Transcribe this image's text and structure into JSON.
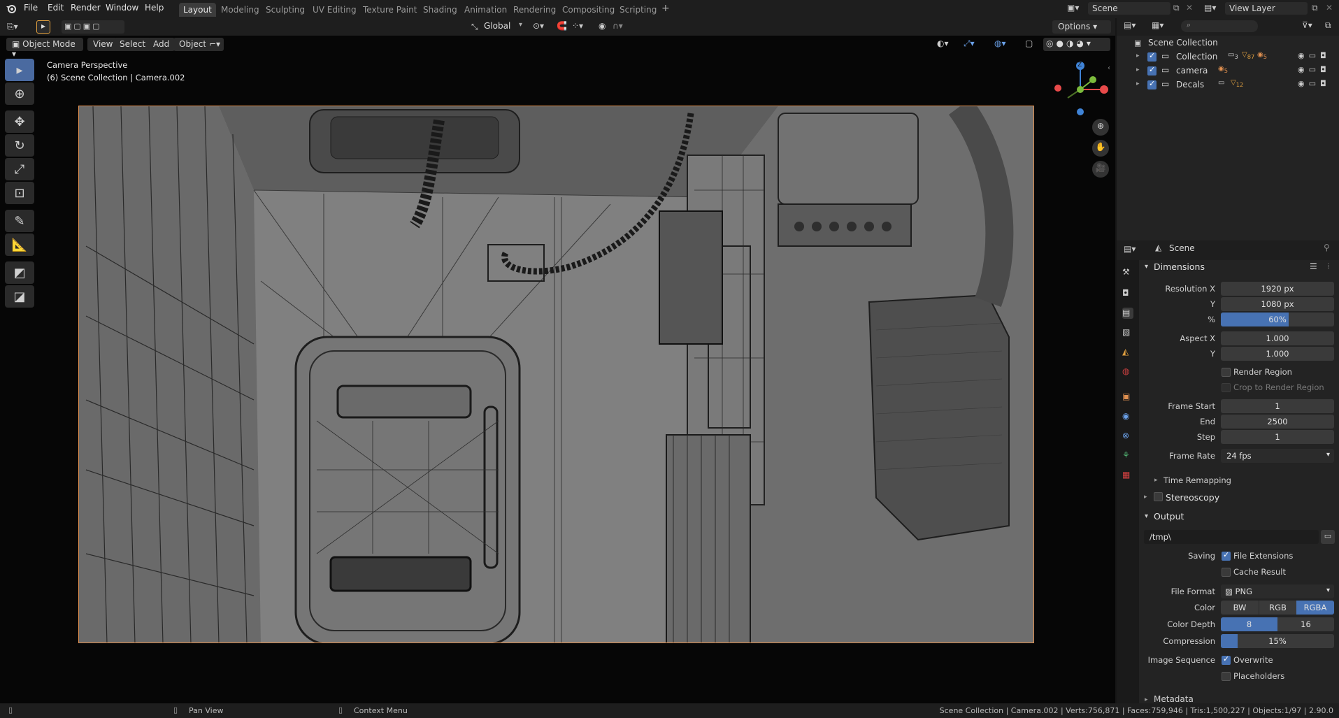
{
  "topbar": {
    "menus": [
      "File",
      "Edit",
      "Render",
      "Window",
      "Help"
    ],
    "workspaces": [
      "Layout",
      "Modeling",
      "Sculpting",
      "UV Editing",
      "Texture Paint",
      "Shading",
      "Animation",
      "Rendering",
      "Compositing",
      "Scripting"
    ],
    "active_workspace": "Layout",
    "scene_name": "Scene",
    "view_layer": "View Layer"
  },
  "toolrow": {
    "transform_orientation": "Global",
    "options_label": "Options"
  },
  "viewport_header": {
    "mode": "Object Mode",
    "view": "View",
    "select": "Select",
    "add": "Add",
    "object": "Object"
  },
  "viewport": {
    "overlay_line1": "Camera Perspective",
    "overlay_line2": "(6) Scene Collection | Camera.002",
    "gizmo_z": "Z"
  },
  "outliner": {
    "root": "Scene Collection",
    "items": [
      {
        "name": "Collection",
        "badge1": "3",
        "badge2": "87",
        "badge3": "5"
      },
      {
        "name": "camera",
        "badge1": "5"
      },
      {
        "name": "Decals",
        "badge1": "12"
      }
    ]
  },
  "properties": {
    "context": "Scene",
    "dimensions_title": "Dimensions",
    "resolution_x_label": "Resolution X",
    "resolution_x": "1920 px",
    "resolution_y_label": "Y",
    "resolution_y": "1080 px",
    "resolution_pct_label": "%",
    "resolution_pct": "60%",
    "resolution_pct_value": 0.6,
    "aspect_x_label": "Aspect X",
    "aspect_x": "1.000",
    "aspect_y_label": "Y",
    "aspect_y": "1.000",
    "render_region": "Render Region",
    "crop_region": "Crop to Render Region",
    "frame_start_label": "Frame Start",
    "frame_start": "1",
    "frame_end_label": "End",
    "frame_end": "2500",
    "frame_step_label": "Step",
    "frame_step": "1",
    "frame_rate_label": "Frame Rate",
    "frame_rate": "24 fps",
    "time_remapping": "Time Remapping",
    "stereoscopy": "Stereoscopy",
    "output_title": "Output",
    "output_path": "/tmp\\",
    "saving_label": "Saving",
    "file_extensions": "File Extensions",
    "cache_result": "Cache Result",
    "file_format_label": "File Format",
    "file_format": "PNG",
    "color_label": "Color",
    "color_options": [
      "BW",
      "RGB",
      "RGBA"
    ],
    "color_selected": "RGBA",
    "color_depth_label": "Color Depth",
    "color_depth_options": [
      "8",
      "16"
    ],
    "color_depth_selected": "8",
    "compression_label": "Compression",
    "compression": "15%",
    "compression_value": 0.15,
    "image_sequence_label": "Image Sequence",
    "overwrite": "Overwrite",
    "placeholders": "Placeholders",
    "metadata": "Metadata"
  },
  "statusbar": {
    "pan_view": "Pan View",
    "context_menu": "Context Menu",
    "stats": "Scene Collection | Camera.002 | Verts:756,871 | Faces:759,946 | Tris:1,500,227 | Objects:1/97 | 2.90.0"
  },
  "colors": {
    "accent": "#4772b3",
    "camera_border": "#e09050",
    "axis_x": "#e84a4a",
    "axis_y": "#7cbb3c",
    "axis_z": "#3f83d6"
  }
}
